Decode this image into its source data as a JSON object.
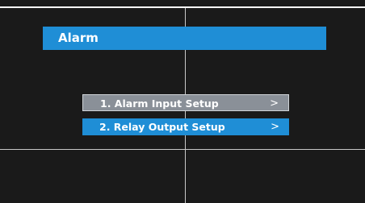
{
  "title": "Alarm",
  "menu": {
    "items": [
      {
        "label": "1. Alarm Input Setup",
        "arrow": ">"
      },
      {
        "label": "2. Relay Output Setup",
        "arrow": ">"
      }
    ]
  },
  "colors": {
    "background": "#1a1a1a",
    "accent": "#1f8ed6",
    "item_inactive": "#8a9098",
    "text": "#ffffff"
  }
}
